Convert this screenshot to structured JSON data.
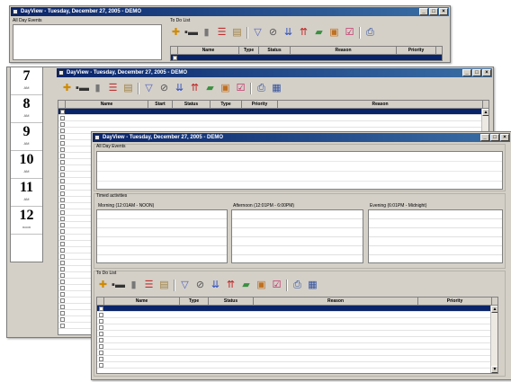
{
  "window_back": {
    "title": "DayView - Tuesday, December 27, 2005 - DEMO",
    "all_day_label": "All Day Events",
    "todo_label": "To Do List",
    "columns": [
      "Name",
      "Type",
      "Status",
      "Reason",
      "Priority"
    ]
  },
  "window_middle": {
    "title": "DayView - Tuesday, December 27, 2005 - DEMO",
    "columns": [
      "Name",
      "Start",
      "Status",
      "Type",
      "Priority",
      "Reason"
    ],
    "hours": [
      {
        "num": "7",
        "suffix": "AM"
      },
      {
        "num": "8",
        "suffix": "AM"
      },
      {
        "num": "9",
        "suffix": "AM"
      },
      {
        "num": "10",
        "suffix": "AM"
      },
      {
        "num": "11",
        "suffix": "AM"
      },
      {
        "num": "12",
        "suffix": "noon"
      }
    ]
  },
  "window_front": {
    "title": "DayView - Tuesday, December 27, 2005 - DEMO",
    "all_day_label": "All Day Events",
    "timed_label": "Timed activities",
    "morning_label": "Morning (12:01AM - NOON)",
    "afternoon_label": "Afternoon (12:01PM - 6:00PM)",
    "evening_label": "Evening (6:01PM - Midnight)",
    "todo_label": "To Do List",
    "columns": [
      "Name",
      "Type",
      "Status",
      "Reason",
      "Priority"
    ]
  },
  "window_buttons": {
    "minimize": "_",
    "maximize": "□",
    "close": "×"
  },
  "toolbar_icons": [
    "add-icon",
    "link-icon",
    "delete-icon",
    "list-icon",
    "document-icon",
    "filter-icon",
    "check-icon",
    "move-down-icon",
    "move-up-icon",
    "notes-icon",
    "folder-icon",
    "done-icon",
    "print-icon",
    "grid-icon"
  ],
  "colors": {
    "titlebar": "#0a246a",
    "selection": "#0a246a",
    "window_bg": "#d4d0c8"
  }
}
